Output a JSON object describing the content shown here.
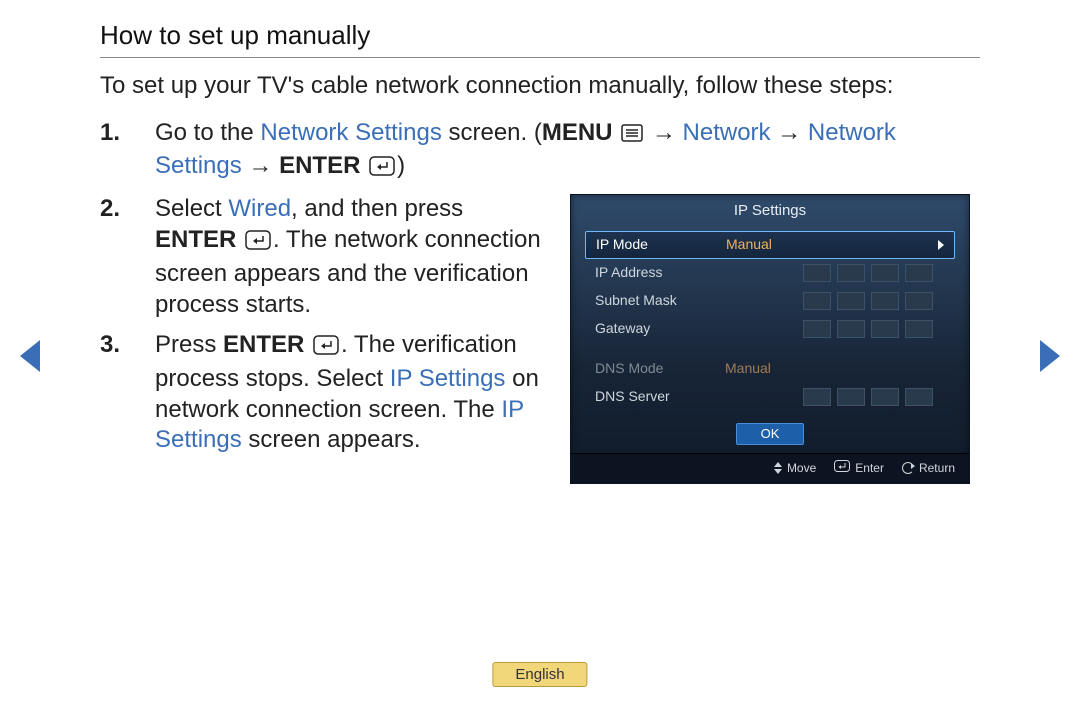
{
  "title": "How to set up manually",
  "intro": "To set up your TV's cable network connection manually, follow these steps:",
  "steps": {
    "s1": {
      "num": "1.",
      "t1": "Go to the ",
      "t2": "Network Settings",
      "t3": " screen. (",
      "t4": "MENU",
      "arrow": " → ",
      "t5": "Network",
      "t6": "Network Settings",
      "t7": "ENTER",
      "t8": ")"
    },
    "s2": {
      "num": "2.",
      "t1": "Select ",
      "t2": "Wired",
      "t3": ", and then press ",
      "t4": "ENTER",
      "t5": ". The network connection screen appears and the verification process starts."
    },
    "s3": {
      "num": "3.",
      "t1": "Press ",
      "t2": "ENTER",
      "t3": ". The verification process stops. Select ",
      "t4": "IP Settings",
      "t5": " on network connection screen. The ",
      "t6": "IP Settings",
      "t7": " screen appears."
    }
  },
  "panel": {
    "title": "IP Settings",
    "rows": {
      "ipmode": {
        "label": "IP Mode",
        "value": "Manual"
      },
      "ipaddr": {
        "label": "IP Address"
      },
      "subnet": {
        "label": "Subnet Mask"
      },
      "gateway": {
        "label": "Gateway"
      },
      "dnsmode": {
        "label": "DNS Mode",
        "value": "Manual"
      },
      "dnssrv": {
        "label": "DNS Server"
      }
    },
    "ok": "OK",
    "footer": {
      "move": "Move",
      "enter": "Enter",
      "return": "Return"
    }
  },
  "lang": "English"
}
